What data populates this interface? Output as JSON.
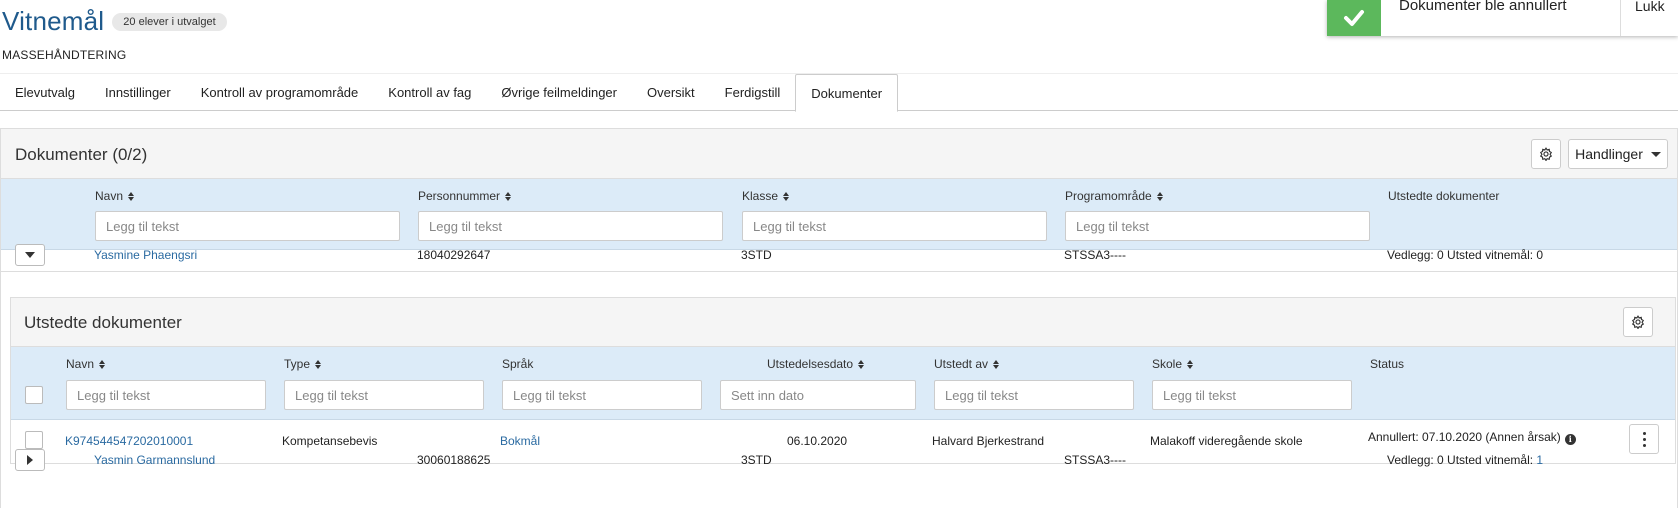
{
  "header": {
    "title": "Vitnemål",
    "badge": "20 elever i utvalget",
    "subtitle": "MASSEHÅNDTERING"
  },
  "toast": {
    "message": "Dokumenter ble annullert",
    "close_label": "Lukk",
    "color": "#5cb85c"
  },
  "tabs": [
    {
      "label": "Elevutvalg"
    },
    {
      "label": "Innstillinger"
    },
    {
      "label": "Kontroll av programområde"
    },
    {
      "label": "Kontroll av fag"
    },
    {
      "label": "Øvrige feilmeldinger"
    },
    {
      "label": "Oversikt"
    },
    {
      "label": "Ferdigstill"
    },
    {
      "label": "Dokumenter",
      "active": true
    }
  ],
  "panel": {
    "title": "Dokumenter (0/2)",
    "actions_label": "Handlinger",
    "columns": [
      "Navn",
      "Personnummer",
      "Klasse",
      "Programområde",
      "Utstedte dokumenter"
    ],
    "filter_placeholder": "Legg til tekst",
    "rows": [
      {
        "name": "Yasmine Phaengsri",
        "pnr": "18040292647",
        "class": "3STD",
        "program": "STSSA3----",
        "docs": "Vedlegg: 0 Utsted vitnemål: 0",
        "expanded": true
      },
      {
        "name": "Yasmin Garmannslund",
        "pnr": "30060188625",
        "class": "3STD",
        "program": "STSSA3----",
        "docs_prefix": "Vedlegg: 0 Utsted vitnemål: ",
        "docs_count": "1"
      }
    ]
  },
  "sub": {
    "title": "Utstedte dokumenter",
    "columns": [
      "Navn",
      "Type",
      "Språk",
      "Utstedelsesdato",
      "Utstedt av",
      "Skole",
      "Status"
    ],
    "filter_placeholder": "Legg til tekst",
    "date_placeholder": "Sett inn dato",
    "row": {
      "name": "K974544547202010001",
      "type": "Kompetansebevis",
      "lang": "Bokmål",
      "date": "06.10.2020",
      "by": "Halvard Bjerkestrand",
      "school": "Malakoff videregående skole",
      "status": "Annullert: 07.10.2020 (Annen årsak)"
    }
  }
}
